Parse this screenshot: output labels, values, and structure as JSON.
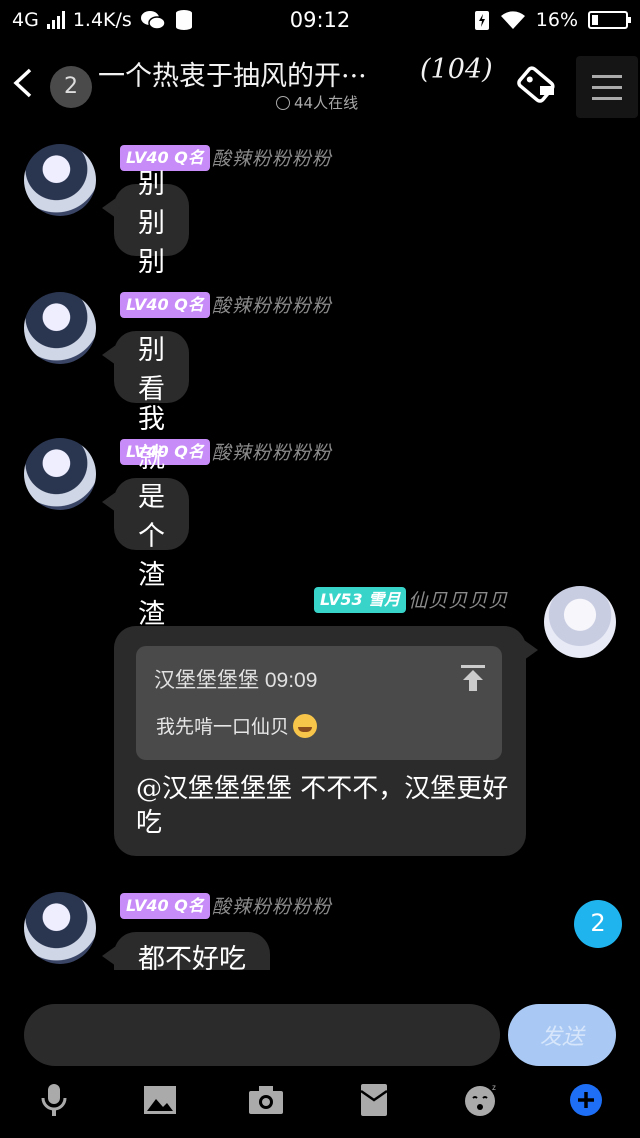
{
  "status_bar": {
    "network": "4G",
    "speed": "1.4K/s",
    "time": "09:12",
    "battery": "16%",
    "battery_level": 0.16
  },
  "header": {
    "group_name": "一个热衷于抽风的开···",
    "member_count": "(104)",
    "online": "44人在线",
    "unread_count": "2"
  },
  "messages": [
    {
      "level": "LV40",
      "title": "Q名",
      "sender": "酸辣粉粉粉粉",
      "text": "别别别"
    },
    {
      "level": "LV40",
      "title": "Q名",
      "sender": "酸辣粉粉粉粉",
      "text": "别看"
    },
    {
      "level": "LV40",
      "title": "Q名",
      "sender": "酸辣粉粉粉粉",
      "text": "我就是个渣渣"
    },
    {
      "level": "LV53",
      "title": "雪月",
      "sender": "仙贝贝贝贝",
      "reply_to": {
        "author": "汉堡堡堡堡",
        "time": "09:09",
        "text": "我先啃一口仙贝"
      },
      "text": "@汉堡堡堡堡 不不不，汉堡更好吃"
    },
    {
      "level": "LV40",
      "title": "Q名",
      "sender": "酸辣粉粉粉粉",
      "text": "都不好吃"
    }
  ],
  "new_messages_badge": "2",
  "input": {
    "placeholder": "",
    "send_label": "发送"
  },
  "colors": {
    "level_purple": "#c78cf7",
    "level_teal": "#38d4c9",
    "badge_blue": "#20b4ee",
    "send_button": "#a9c9f4"
  },
  "toolbar_icons": [
    "microphone-icon",
    "image-icon",
    "camera-icon",
    "red-packet-icon",
    "emoji-icon",
    "plus-icon"
  ]
}
